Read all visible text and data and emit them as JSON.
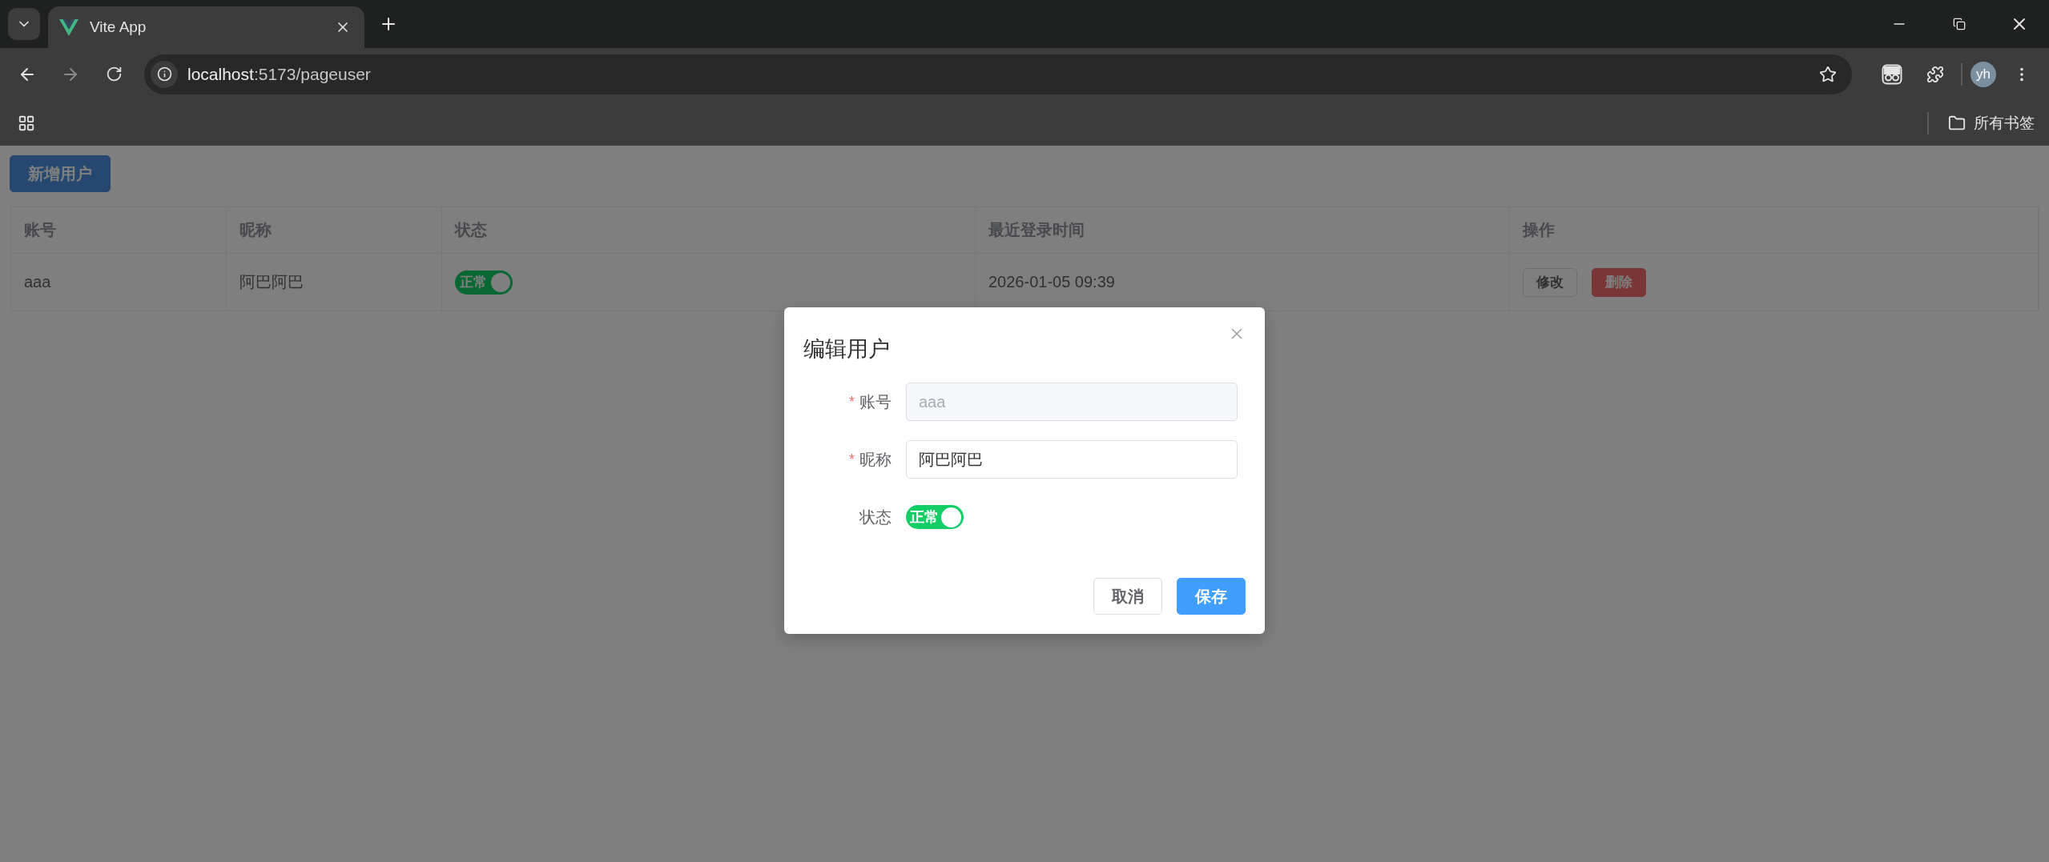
{
  "browser": {
    "tab_title": "Vite App",
    "url_host": "localhost",
    "url_path": ":5173/pageuser",
    "avatar": "yh",
    "bookmarks_label": "所有书签"
  },
  "page": {
    "add_button": "新增用户",
    "table": {
      "columns": [
        "账号",
        "昵称",
        "状态",
        "最近登录时间",
        "操作"
      ],
      "rows": [
        {
          "account": "aaa",
          "nickname": "阿巴阿巴",
          "status": {
            "label": "正常",
            "on": true
          },
          "last_login": "2026-01-05 09:39",
          "actions": [
            {
              "label": "修改",
              "kind": "default"
            },
            {
              "label": "删除",
              "kind": "danger"
            }
          ]
        }
      ]
    }
  },
  "dialog": {
    "title": "编辑用户",
    "fields": [
      {
        "kind": "text",
        "required_mark": "*",
        "label": "账号",
        "value": "aaa",
        "disabled": true
      },
      {
        "kind": "text",
        "required_mark": "*",
        "label": "昵称",
        "value": "阿巴阿巴",
        "disabled": false
      },
      {
        "kind": "switch",
        "label": "状态",
        "switch_label": "正常",
        "on": true
      }
    ],
    "buttons": [
      {
        "label": "取消",
        "kind": "default"
      },
      {
        "label": "保存",
        "kind": "primary"
      }
    ]
  }
}
